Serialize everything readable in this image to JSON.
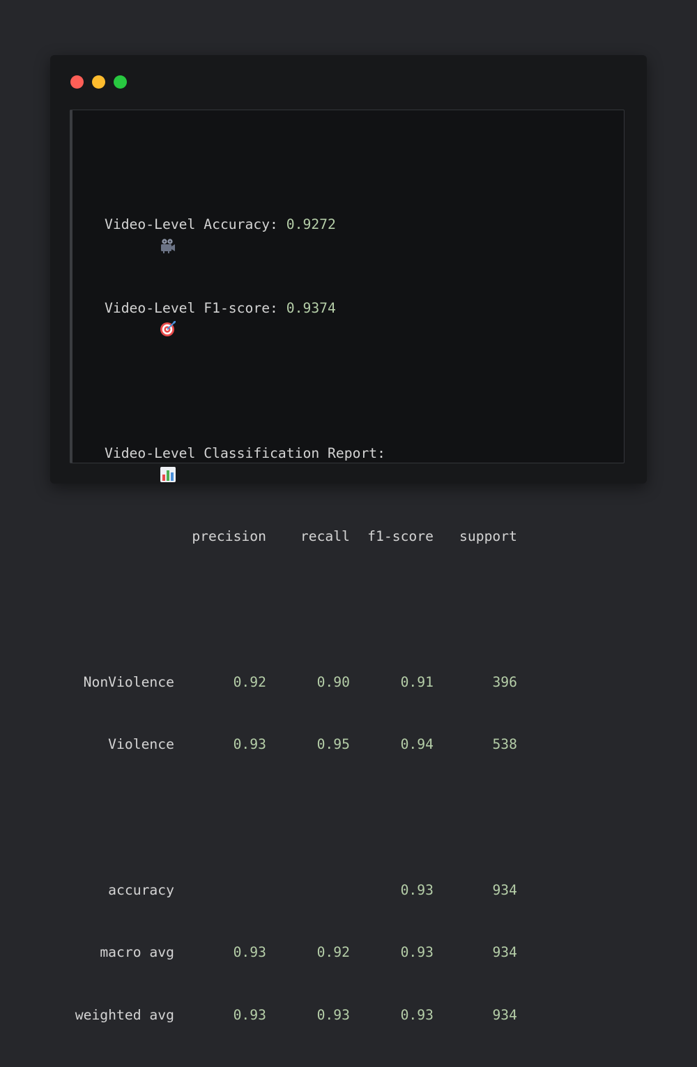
{
  "window": {
    "traffic_lights": [
      {
        "name": "close",
        "color": "#ff5f57"
      },
      {
        "name": "minimize",
        "color": "#febc2e"
      },
      {
        "name": "maximize",
        "color": "#28c840"
      }
    ]
  },
  "output": {
    "accuracy_label": "Video-Level Accuracy: ",
    "accuracy_value": "0.9272",
    "accuracy_icon": "movie-camera-icon",
    "f1_label": "Video-Level F1-score: ",
    "f1_value": "0.9374",
    "f1_icon": "target-icon",
    "report_label": "Video-Level Classification Report:",
    "report_icon": "bar-chart-icon"
  },
  "report": {
    "headers": [
      "precision",
      "recall",
      "f1-score",
      "support"
    ],
    "rows": [
      {
        "label": "NonViolence",
        "precision": "0.92",
        "recall": "0.90",
        "f1": "0.91",
        "support": "396"
      },
      {
        "label": "Violence",
        "precision": "0.93",
        "recall": "0.95",
        "f1": "0.94",
        "support": "538"
      }
    ],
    "summary": [
      {
        "label": "accuracy",
        "precision": "",
        "recall": "",
        "f1": "0.93",
        "support": "934"
      },
      {
        "label": "macro avg",
        "precision": "0.93",
        "recall": "0.92",
        "f1": "0.93",
        "support": "934"
      },
      {
        "label": "weighted avg",
        "precision": "0.93",
        "recall": "0.93",
        "f1": "0.93",
        "support": "934"
      }
    ]
  }
}
